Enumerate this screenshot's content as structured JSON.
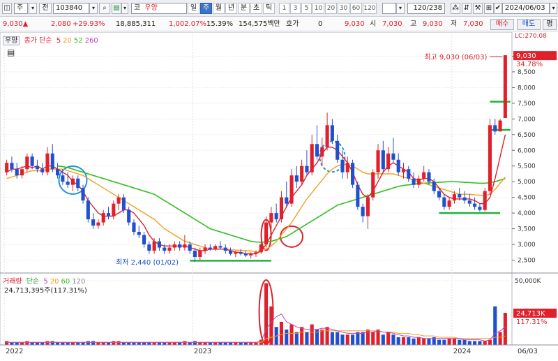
{
  "toolbar": {
    "item_type": "주",
    "search_type": "전",
    "code": "103840",
    "market": "코",
    "stock_name": "우양",
    "periods": [
      {
        "label": "일",
        "active": false
      },
      {
        "label": "주",
        "active": true
      },
      {
        "label": "월",
        "active": false
      },
      {
        "label": "년",
        "active": false
      },
      {
        "label": "분",
        "active": false
      },
      {
        "label": "초",
        "active": false
      },
      {
        "label": "틱",
        "active": false
      }
    ],
    "intervals": [
      "1",
      "3",
      "5",
      "10",
      "20",
      "30",
      "60",
      "120"
    ],
    "count": "120/238",
    "date": "2024/06/03"
  },
  "quote": {
    "price": "9,030",
    "change": "2,080",
    "change_pct": "+29.93%",
    "volume": "18,885,311",
    "volume_ratio": "1,002.07%",
    "turnover": "15.39%",
    "amount": "154,575백만",
    "hoga_label": "호가",
    "hoga_value": "0",
    "hoga_price": "9,030",
    "open_label": "시",
    "open": "7,030",
    "high_label": "고",
    "high": "9,030",
    "low_label": "저",
    "low": "7,030",
    "buy_label": "매수",
    "sell_label": "매도",
    "eval_label": "평"
  },
  "price_panel": {
    "name": "우양",
    "ma_label": "종가 단순",
    "ma_periods": [
      "5",
      "20",
      "52",
      "260"
    ],
    "ma_colors": [
      "#e0202a",
      "#f0a020",
      "#30c020",
      "#c040c0"
    ],
    "lc": "LC:270.08",
    "current_price": "9,030",
    "current_pct": "34.78%",
    "high_note": "최고 9,030 (06/03)",
    "low_note": "최저 2,440 (01/02)",
    "axis": [
      "9,000",
      "8,500",
      "8,000",
      "7,500",
      "7,000",
      "6,500",
      "6,000",
      "5,500",
      "5,000",
      "4,500",
      "4,000",
      "3,500",
      "3,000",
      "2,500"
    ]
  },
  "volume_panel": {
    "label": "거래량",
    "ma_label": "단순",
    "ma_periods": [
      "5",
      "20",
      "60",
      "120"
    ],
    "ma_colors": [
      "#c040c0",
      "#f0a020",
      "#30c020",
      "#888888"
    ],
    "current": "24,713,395주(117.31%)",
    "axis_top": "50,000K",
    "current_tag": "24,713K",
    "current_pct": "117.31%"
  },
  "x_axis": [
    "2022",
    "2023",
    "2024",
    "06/03"
  ],
  "colors": {
    "up": "#e0202a",
    "down": "#2050d0",
    "accent": "#3b73c9"
  },
  "chart_data": {
    "type": "candlestick",
    "period": "weekly",
    "x_labels": [
      "2022",
      "2023",
      "2024"
    ],
    "y_range": [
      2200,
      9500
    ],
    "candles": [
      {
        "o": 5300,
        "h": 5700,
        "l": 5200,
        "c": 5600
      },
      {
        "o": 5600,
        "h": 5800,
        "l": 5300,
        "c": 5400
      },
      {
        "o": 5400,
        "h": 5600,
        "l": 5100,
        "c": 5200
      },
      {
        "o": 5200,
        "h": 5500,
        "l": 5100,
        "c": 5400
      },
      {
        "o": 5400,
        "h": 5900,
        "l": 5300,
        "c": 5800
      },
      {
        "o": 5800,
        "h": 5900,
        "l": 5400,
        "c": 5500
      },
      {
        "o": 5500,
        "h": 5700,
        "l": 5300,
        "c": 5400
      },
      {
        "o": 5400,
        "h": 5600,
        "l": 5200,
        "c": 5300
      },
      {
        "o": 5300,
        "h": 6100,
        "l": 5200,
        "c": 5900
      },
      {
        "o": 5900,
        "h": 6200,
        "l": 5300,
        "c": 5400
      },
      {
        "o": 5400,
        "h": 5600,
        "l": 5100,
        "c": 5200
      },
      {
        "o": 5200,
        "h": 5400,
        "l": 4900,
        "c": 5000
      },
      {
        "o": 5000,
        "h": 5300,
        "l": 4800,
        "c": 4900
      },
      {
        "o": 4900,
        "h": 5200,
        "l": 4700,
        "c": 5100
      },
      {
        "o": 5100,
        "h": 5200,
        "l": 4700,
        "c": 4800
      },
      {
        "o": 4800,
        "h": 4900,
        "l": 4300,
        "c": 4400
      },
      {
        "o": 4400,
        "h": 4500,
        "l": 3700,
        "c": 3800
      },
      {
        "o": 3800,
        "h": 4000,
        "l": 3500,
        "c": 3600
      },
      {
        "o": 3600,
        "h": 3800,
        "l": 3500,
        "c": 3700
      },
      {
        "o": 3700,
        "h": 4100,
        "l": 3600,
        "c": 4000
      },
      {
        "o": 4000,
        "h": 4200,
        "l": 3800,
        "c": 3900
      },
      {
        "o": 3900,
        "h": 4400,
        "l": 3800,
        "c": 4300
      },
      {
        "o": 4300,
        "h": 4600,
        "l": 4100,
        "c": 4500
      },
      {
        "o": 4500,
        "h": 4600,
        "l": 4000,
        "c": 4100
      },
      {
        "o": 4100,
        "h": 4200,
        "l": 3600,
        "c": 3700
      },
      {
        "o": 3700,
        "h": 3800,
        "l": 3300,
        "c": 3400
      },
      {
        "o": 3400,
        "h": 3600,
        "l": 3200,
        "c": 3300
      },
      {
        "o": 3300,
        "h": 3400,
        "l": 2900,
        "c": 3000
      },
      {
        "o": 3000,
        "h": 3100,
        "l": 2700,
        "c": 2800
      },
      {
        "o": 2800,
        "h": 3200,
        "l": 2700,
        "c": 3100
      },
      {
        "o": 3100,
        "h": 3200,
        "l": 2800,
        "c": 2900
      },
      {
        "o": 2900,
        "h": 3000,
        "l": 2700,
        "c": 2800
      },
      {
        "o": 2800,
        "h": 3000,
        "l": 2700,
        "c": 2900
      },
      {
        "o": 2900,
        "h": 3100,
        "l": 2800,
        "c": 3000
      },
      {
        "o": 3000,
        "h": 3100,
        "l": 2800,
        "c": 2900
      },
      {
        "o": 2900,
        "h": 3300,
        "l": 2800,
        "c": 3000
      },
      {
        "o": 3000,
        "h": 3100,
        "l": 2700,
        "c": 2800
      },
      {
        "o": 2800,
        "h": 2900,
        "l": 2440,
        "c": 2600
      },
      {
        "o": 2600,
        "h": 2900,
        "l": 2500,
        "c": 2800
      },
      {
        "o": 2800,
        "h": 3000,
        "l": 2700,
        "c": 2900
      },
      {
        "o": 2900,
        "h": 3000,
        "l": 2800,
        "c": 2850
      },
      {
        "o": 2850,
        "h": 3000,
        "l": 2800,
        "c": 2950
      },
      {
        "o": 2950,
        "h": 3100,
        "l": 2850,
        "c": 2900
      },
      {
        "o": 2900,
        "h": 3000,
        "l": 2700,
        "c": 2800
      },
      {
        "o": 2800,
        "h": 2900,
        "l": 2650,
        "c": 2700
      },
      {
        "o": 2700,
        "h": 2800,
        "l": 2600,
        "c": 2750
      },
      {
        "o": 2750,
        "h": 2850,
        "l": 2650,
        "c": 2700
      },
      {
        "o": 2700,
        "h": 2800,
        "l": 2600,
        "c": 2650
      },
      {
        "o": 2650,
        "h": 2750,
        "l": 2550,
        "c": 2700
      },
      {
        "o": 2700,
        "h": 2800,
        "l": 2600,
        "c": 2750
      },
      {
        "o": 2750,
        "h": 3100,
        "l": 2700,
        "c": 3000
      },
      {
        "o": 3000,
        "h": 3900,
        "l": 2900,
        "c": 3700
      },
      {
        "o": 3700,
        "h": 4200,
        "l": 3500,
        "c": 4000
      },
      {
        "o": 4000,
        "h": 4300,
        "l": 3700,
        "c": 3800
      },
      {
        "o": 3800,
        "h": 4700,
        "l": 3700,
        "c": 4500
      },
      {
        "o": 4500,
        "h": 5000,
        "l": 4200,
        "c": 4300
      },
      {
        "o": 4300,
        "h": 5400,
        "l": 4200,
        "c": 5200
      },
      {
        "o": 5200,
        "h": 5500,
        "l": 4800,
        "c": 5000
      },
      {
        "o": 5000,
        "h": 5700,
        "l": 4900,
        "c": 5500
      },
      {
        "o": 5500,
        "h": 6000,
        "l": 5200,
        "c": 5300
      },
      {
        "o": 5300,
        "h": 6500,
        "l": 5200,
        "c": 6200
      },
      {
        "o": 6200,
        "h": 6800,
        "l": 5700,
        "c": 5800
      },
      {
        "o": 5800,
        "h": 6400,
        "l": 5500,
        "c": 6100
      },
      {
        "o": 6100,
        "h": 7200,
        "l": 6000,
        "c": 6800
      },
      {
        "o": 6800,
        "h": 7000,
        "l": 6200,
        "c": 6300
      },
      {
        "o": 6300,
        "h": 6500,
        "l": 5600,
        "c": 5700
      },
      {
        "o": 5700,
        "h": 6000,
        "l": 5100,
        "c": 5300
      },
      {
        "o": 5300,
        "h": 5800,
        "l": 5100,
        "c": 5600
      },
      {
        "o": 5600,
        "h": 5700,
        "l": 4800,
        "c": 4900
      },
      {
        "o": 4900,
        "h": 5000,
        "l": 4100,
        "c": 4200
      },
      {
        "o": 4200,
        "h": 4300,
        "l": 3700,
        "c": 3900
      },
      {
        "o": 3900,
        "h": 4600,
        "l": 3500,
        "c": 4500
      },
      {
        "o": 4500,
        "h": 5400,
        "l": 4400,
        "c": 5300
      },
      {
        "o": 5300,
        "h": 6200,
        "l": 5100,
        "c": 6000
      },
      {
        "o": 6000,
        "h": 6300,
        "l": 5300,
        "c": 5400
      },
      {
        "o": 5400,
        "h": 6100,
        "l": 5300,
        "c": 5900
      },
      {
        "o": 5900,
        "h": 6400,
        "l": 5600,
        "c": 5700
      },
      {
        "o": 5700,
        "h": 5900,
        "l": 5200,
        "c": 5300
      },
      {
        "o": 5300,
        "h": 5600,
        "l": 5100,
        "c": 5400
      },
      {
        "o": 5400,
        "h": 5500,
        "l": 5000,
        "c": 5100
      },
      {
        "o": 5100,
        "h": 5300,
        "l": 4800,
        "c": 4900
      },
      {
        "o": 4900,
        "h": 5200,
        "l": 4800,
        "c": 5100
      },
      {
        "o": 5100,
        "h": 5500,
        "l": 5000,
        "c": 5300
      },
      {
        "o": 5300,
        "h": 5400,
        "l": 4900,
        "c": 5000
      },
      {
        "o": 5000,
        "h": 5100,
        "l": 4600,
        "c": 4700
      },
      {
        "o": 4700,
        "h": 4800,
        "l": 4400,
        "c": 4500
      },
      {
        "o": 4500,
        "h": 4600,
        "l": 4100,
        "c": 4200
      },
      {
        "o": 4200,
        "h": 4500,
        "l": 4100,
        "c": 4400
      },
      {
        "o": 4400,
        "h": 4700,
        "l": 4300,
        "c": 4600
      },
      {
        "o": 4600,
        "h": 4800,
        "l": 4400,
        "c": 4500
      },
      {
        "o": 4500,
        "h": 4700,
        "l": 4300,
        "c": 4400
      },
      {
        "o": 4400,
        "h": 4600,
        "l": 4200,
        "c": 4300
      },
      {
        "o": 4300,
        "h": 4500,
        "l": 4100,
        "c": 4200
      },
      {
        "o": 4200,
        "h": 4300,
        "l": 4050,
        "c": 4100
      },
      {
        "o": 4100,
        "h": 4800,
        "l": 4050,
        "c": 4700
      },
      {
        "o": 4700,
        "h": 7000,
        "l": 4600,
        "c": 6800
      },
      {
        "o": 6800,
        "h": 7000,
        "l": 6500,
        "c": 6600
      },
      {
        "o": 6600,
        "h": 7000,
        "l": 6600,
        "c": 6950
      },
      {
        "o": 7030,
        "h": 9030,
        "l": 7030,
        "c": 9030
      }
    ],
    "ma5": [
      5300,
      5400,
      5400,
      5450,
      5500,
      5450,
      5500,
      5400,
      5500,
      5500,
      5400,
      5300,
      5200,
      5000,
      4900,
      4700,
      4400,
      4200,
      4000,
      3900,
      3900,
      3900,
      4000,
      4100,
      4100,
      4000,
      3800,
      3600,
      3300,
      3100,
      3000,
      2950,
      2950,
      2950,
      2950,
      2950,
      2900,
      2850,
      2800,
      2800,
      2850,
      2850,
      2850,
      2850,
      2800,
      2750,
      2750,
      2700,
      2700,
      2700,
      2800,
      3000,
      3300,
      3600,
      3900,
      4200,
      4500,
      4700,
      4900,
      5200,
      5400,
      5600,
      5900,
      6100,
      6100,
      6000,
      5800,
      5600,
      5300,
      4900,
      4600,
      4500,
      4700,
      5000,
      5300,
      5500,
      5600,
      5500,
      5400,
      5300,
      5100,
      5050,
      5100,
      5100,
      5000,
      4800,
      4600,
      4500,
      4450,
      4450,
      4450,
      4450,
      4400,
      4300,
      4300,
      4500,
      5100,
      5800,
      6500
    ],
    "ma20": [
      5100,
      5150,
      5200,
      5250,
      5300,
      5350,
      5350,
      5350,
      5400,
      5400,
      5400,
      5400,
      5350,
      5300,
      5250,
      5200,
      5100,
      5000,
      4900,
      4800,
      4700,
      4600,
      4500,
      4400,
      4300,
      4200,
      4100,
      4000,
      3900,
      3800,
      3650,
      3500,
      3400,
      3300,
      3200,
      3100,
      3050,
      3000,
      2950,
      2900,
      2850,
      2850,
      2850,
      2850,
      2830,
      2820,
      2810,
      2800,
      2790,
      2780,
      2800,
      2850,
      2950,
      3100,
      3300,
      3500,
      3700,
      3950,
      4200,
      4450,
      4650,
      4850,
      5050,
      5250,
      5400,
      5500,
      5550,
      5550,
      5500,
      5400,
      5300,
      5250,
      5250,
      5250,
      5250,
      5250,
      5250,
      5200,
      5150,
      5100,
      5050,
      5000,
      4950,
      4900,
      4850,
      4800,
      4750,
      4700,
      4650,
      4600,
      4600,
      4600,
      4580,
      4570,
      4560,
      4600,
      4750,
      4950,
      5150
    ],
    "ma52": [
      null,
      null,
      null,
      null,
      null,
      null,
      null,
      null,
      null,
      null,
      5500,
      5480,
      5450,
      5400,
      5350,
      5300,
      5250,
      5200,
      5150,
      5100,
      5050,
      5000,
      4950,
      4900,
      4850,
      4800,
      4750,
      4700,
      4650,
      4600,
      4500,
      4400,
      4300,
      4200,
      4100,
      4000,
      3900,
      3800,
      3700,
      3600,
      3500,
      3450,
      3400,
      3350,
      3300,
      3250,
      3200,
      3150,
      3100,
      3080,
      3070,
      3080,
      3100,
      3150,
      3200,
      3250,
      3350,
      3450,
      3550,
      3650,
      3750,
      3850,
      3950,
      4050,
      4150,
      4250,
      4300,
      4350,
      4400,
      4450,
      4500,
      4550,
      4600,
      4650,
      4700,
      4750,
      4800,
      4850,
      4880,
      4900,
      4920,
      4940,
      4950,
      4960,
      4970,
      4980,
      4990,
      5000,
      5000,
      4990,
      4980,
      4970,
      4960,
      4950,
      4950,
      4970,
      5000,
      5050,
      5100
    ],
    "volume": [
      3,
      2,
      2,
      2,
      3,
      2,
      2,
      2,
      3,
      3,
      2,
      2,
      2,
      2,
      2,
      2,
      3,
      3,
      2,
      2,
      2,
      3,
      3,
      2,
      2,
      2,
      2,
      2,
      2,
      2,
      2,
      2,
      2,
      2,
      2,
      3,
      2,
      3,
      2,
      2,
      2,
      2,
      2,
      2,
      2,
      2,
      2,
      2,
      2,
      2,
      4,
      48,
      30,
      14,
      18,
      12,
      16,
      10,
      14,
      10,
      16,
      12,
      12,
      14,
      10,
      10,
      8,
      8,
      8,
      10,
      10,
      12,
      10,
      12,
      8,
      10,
      8,
      6,
      6,
      6,
      5,
      6,
      5,
      5,
      6,
      4,
      4,
      5,
      5,
      4,
      4,
      3,
      3,
      3,
      3,
      4,
      30,
      10,
      25
    ],
    "volume_ma5": [
      2,
      2,
      2,
      2,
      2,
      2,
      2,
      2,
      2,
      2,
      2,
      2,
      2,
      2,
      2,
      2,
      2,
      2,
      2,
      2,
      2,
      2,
      2,
      2,
      2,
      2,
      2,
      2,
      2,
      2,
      2,
      2,
      2,
      2,
      2,
      2,
      2,
      2,
      2,
      2,
      2,
      2,
      2,
      2,
      2,
      2,
      2,
      2,
      2,
      2,
      3,
      12,
      18,
      22,
      24,
      18,
      16,
      14,
      13,
      12,
      12,
      12,
      13,
      13,
      12,
      11,
      10,
      9,
      9,
      9,
      9,
      10,
      10,
      11,
      10,
      10,
      9,
      8,
      7,
      7,
      6,
      6,
      5,
      5,
      5,
      5,
      5,
      5,
      5,
      5,
      4,
      4,
      4,
      4,
      3,
      4,
      9,
      11,
      14
    ],
    "volume_ma20": [
      2,
      2,
      2,
      2,
      2,
      2,
      2,
      2,
      2,
      2,
      2,
      2,
      2,
      2,
      2,
      2,
      2,
      2,
      2,
      2,
      2,
      2,
      2,
      2,
      2,
      2,
      2,
      2,
      2,
      2,
      2,
      2,
      2,
      2,
      2,
      2,
      2,
      2,
      2,
      2,
      2,
      2,
      2,
      2,
      2,
      2,
      2,
      2,
      2,
      2,
      2,
      5,
      6,
      7,
      8,
      9,
      9,
      9,
      10,
      10,
      10,
      10,
      11,
      11,
      11,
      11,
      11,
      11,
      11,
      11,
      11,
      11,
      11,
      11,
      10,
      10,
      10,
      9,
      9,
      9,
      8,
      8,
      7,
      7,
      7,
      6,
      6,
      6,
      6,
      5,
      5,
      5,
      5,
      5,
      5,
      5,
      6,
      6,
      7
    ],
    "volume_max": 50
  }
}
